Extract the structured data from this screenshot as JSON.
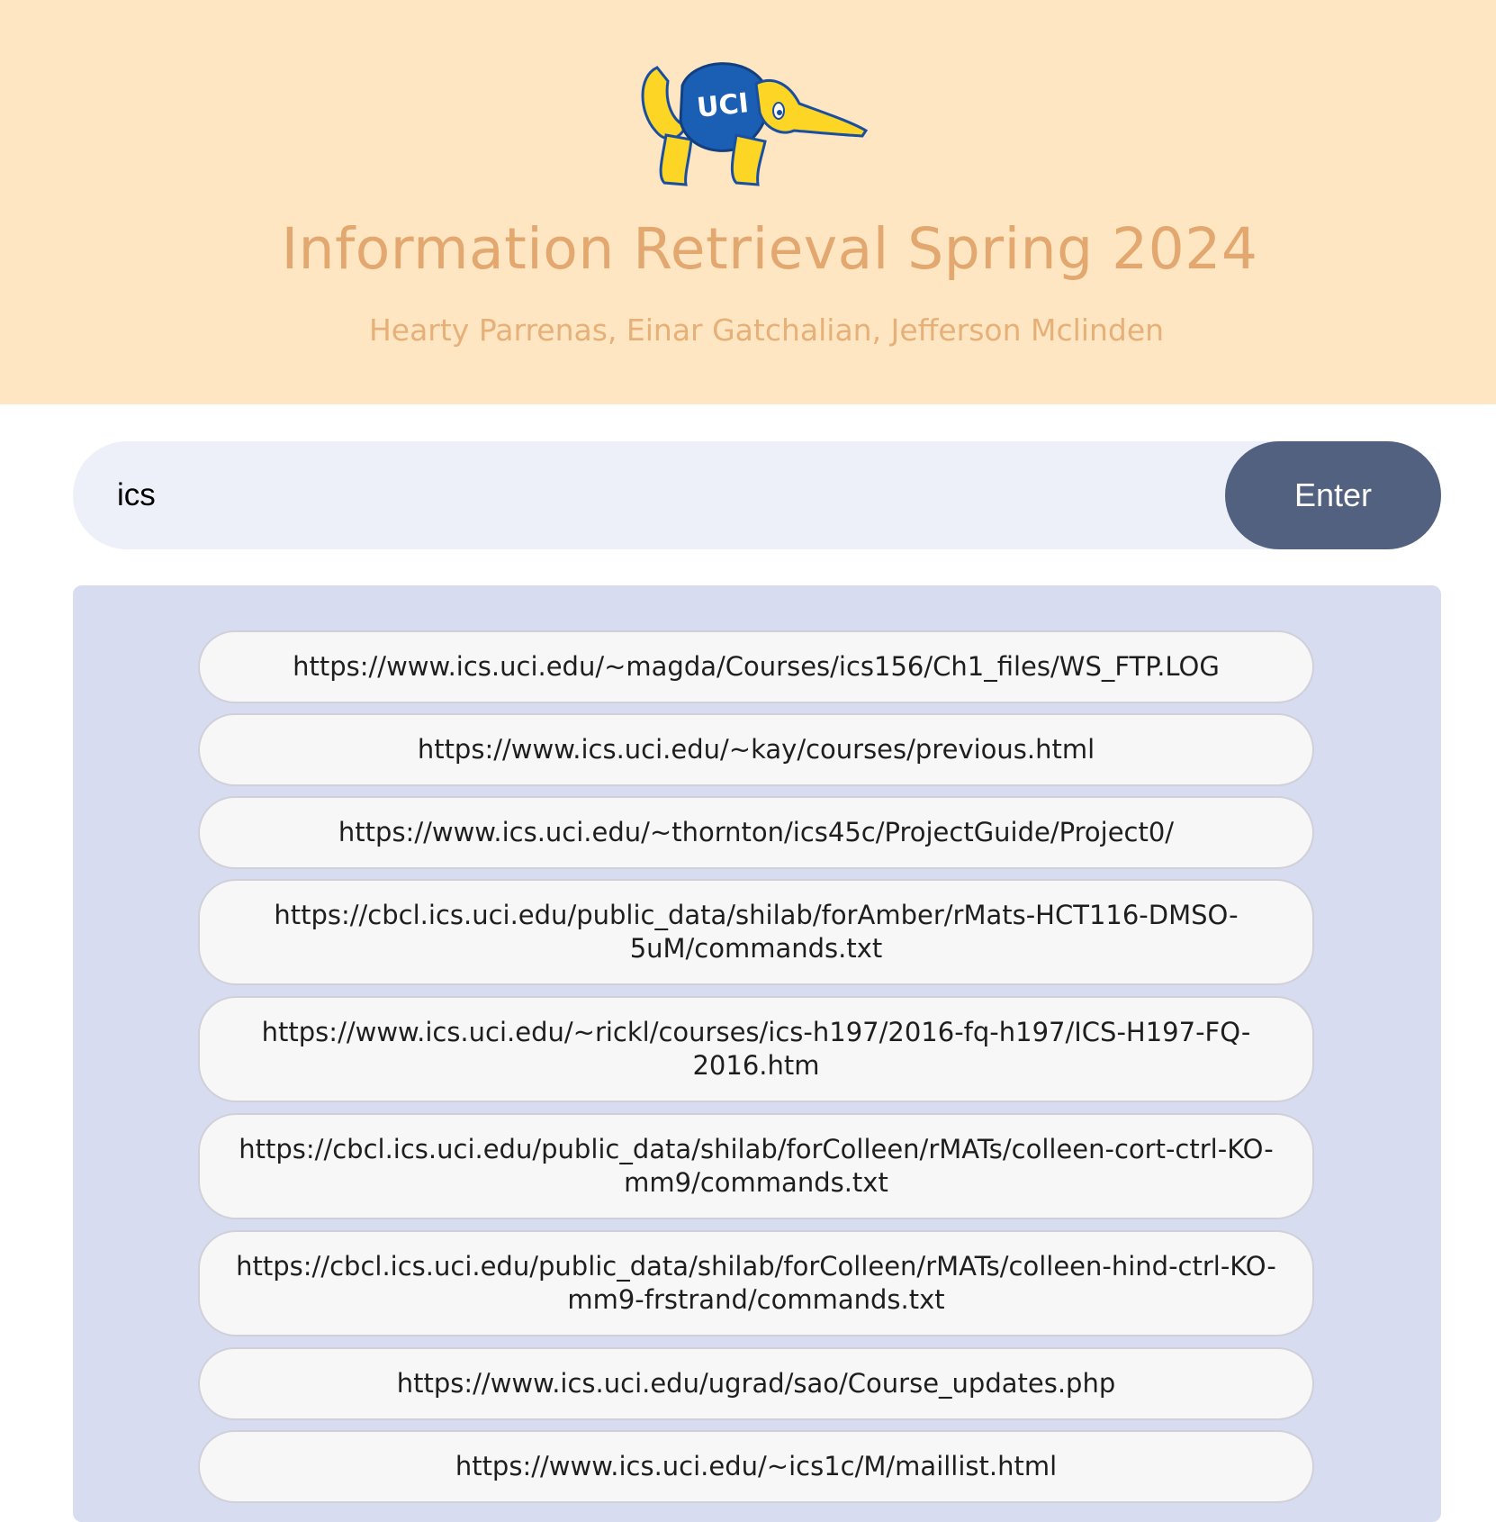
{
  "header": {
    "logo_text": "UCI",
    "title": "Information Retrieval Spring 2024",
    "subtitle": "Hearty Parrenas, Einar Gatchalian, Jefferson Mclinden"
  },
  "search": {
    "value": "ics",
    "button_label": "Enter"
  },
  "results": [
    "https://www.ics.uci.edu/~magda/Courses/ics156/Ch1_files/WS_FTP.LOG",
    "https://www.ics.uci.edu/~kay/courses/previous.html",
    "https://www.ics.uci.edu/~thornton/ics45c/ProjectGuide/Project0/",
    "https://cbcl.ics.uci.edu/public_data/shilab/forAmber/rMats-HCT116-DMSO-5uM/commands.txt",
    "https://www.ics.uci.edu/~rickl/courses/ics-h197/2016-fq-h197/ICS-H197-FQ-2016.htm",
    "https://cbcl.ics.uci.edu/public_data/shilab/forColleen/rMATs/colleen-cort-ctrl-KO-mm9/commands.txt",
    "https://cbcl.ics.uci.edu/public_data/shilab/forColleen/rMATs/colleen-hind-ctrl-KO-mm9-frstrand/commands.txt",
    "https://www.ics.uci.edu/ugrad/sao/Course_updates.php",
    "https://www.ics.uci.edu/~ics1c/M/maillist.html"
  ],
  "colors": {
    "header_bg": "#fee6c3",
    "title": "#e2a870",
    "button": "#536180",
    "panel": "#d7dcf1"
  }
}
